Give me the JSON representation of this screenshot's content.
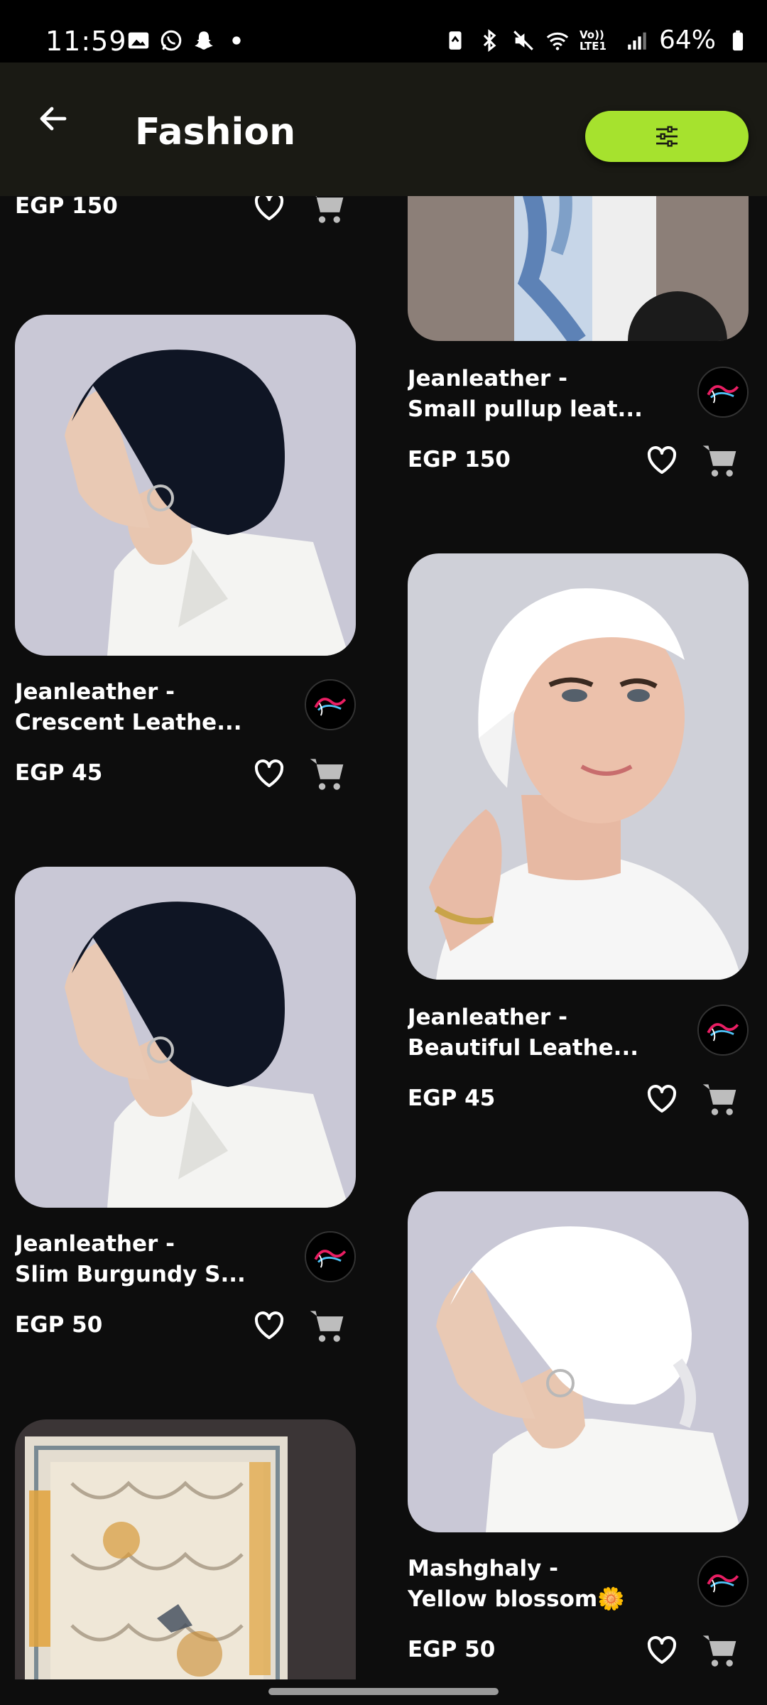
{
  "status_bar": {
    "time": "11:59",
    "network_label": "Vo)) LTE1",
    "battery": "64%"
  },
  "header": {
    "title": "Fashion",
    "back_icon": "arrow-left-icon",
    "filter_icon": "sliders-icon",
    "accent_color": "#a6e22e"
  },
  "products": [
    {
      "price": "EGP 150"
    },
    {
      "name_line1": "Jeanleather  -",
      "name_line2": "Small pullup leat...",
      "price": "EGP 150"
    },
    {
      "name_line1": "Jeanleather  -",
      "name_line2": "Crescent Leathe...",
      "price": "EGP 45"
    },
    {
      "name_line1": "Jeanleather  -",
      "name_line2": "Beautiful Leathe...",
      "price": "EGP 45"
    },
    {
      "name_line1": "Jeanleather  -",
      "name_line2": "Slim Burgundy S...",
      "price": "EGP 50"
    },
    {
      "name_line1": "Mashghaly -",
      "name_line2": "Yellow blossom🌼",
      "price": "EGP 50"
    },
    {}
  ]
}
